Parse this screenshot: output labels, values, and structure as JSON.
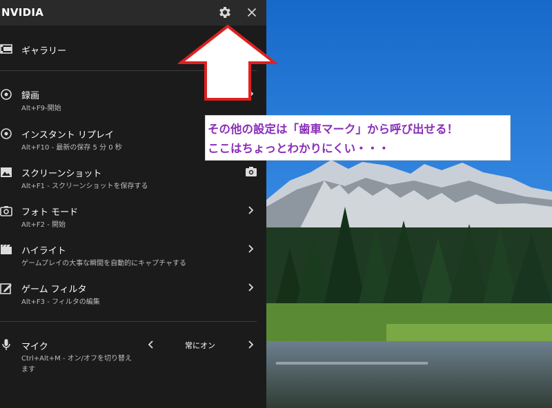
{
  "window": {
    "brand": "NVIDIA",
    "settings_icon": "gear-icon",
    "close_icon": "close-icon"
  },
  "gallery": {
    "label": "ギャラリー",
    "icon": "film-gallery-icon"
  },
  "items": [
    {
      "title": "録画",
      "sub": "Alt+F9-開始",
      "icon": "record-icon",
      "trailing": "chevron-right-icon"
    },
    {
      "title": "インスタント リプレイ",
      "sub": "Alt+F10 - 最新の保存 5 分 0 秒",
      "icon": "instant-replay-icon",
      "trailing": ""
    },
    {
      "title": "スクリーンショット",
      "sub": "Alt+F1 - スクリーンショットを保存する",
      "icon": "screenshot-icon",
      "trailing": "camera-icon"
    },
    {
      "title": "フォト モード",
      "sub": "Alt+F2 - 開始",
      "icon": "photo-mode-icon",
      "trailing": "chevron-right-icon"
    },
    {
      "title": "ハイライト",
      "sub": "ゲームプレイの大事な瞬間を自動的にキャプチャする",
      "icon": "highlight-icon",
      "trailing": "chevron-right-icon"
    },
    {
      "title": "ゲーム フィルタ",
      "sub": "Alt+F3 - フィルタの編集",
      "icon": "game-filter-icon",
      "trailing": "chevron-right-icon"
    }
  ],
  "mic": {
    "title": "マイク",
    "sub_line1": "Ctrl+Alt+M - オン/オフを切り替え",
    "sub_line2": "ます",
    "value": "常にオン",
    "icon": "microphone-icon"
  },
  "annotation": {
    "line1": "その他の設定は「歯車マーク」から呼び出せる！",
    "line2": "ここはちょっとわかりにくい・・・",
    "text_color": "#8b2fb8",
    "arrow_color": "#e02020"
  }
}
